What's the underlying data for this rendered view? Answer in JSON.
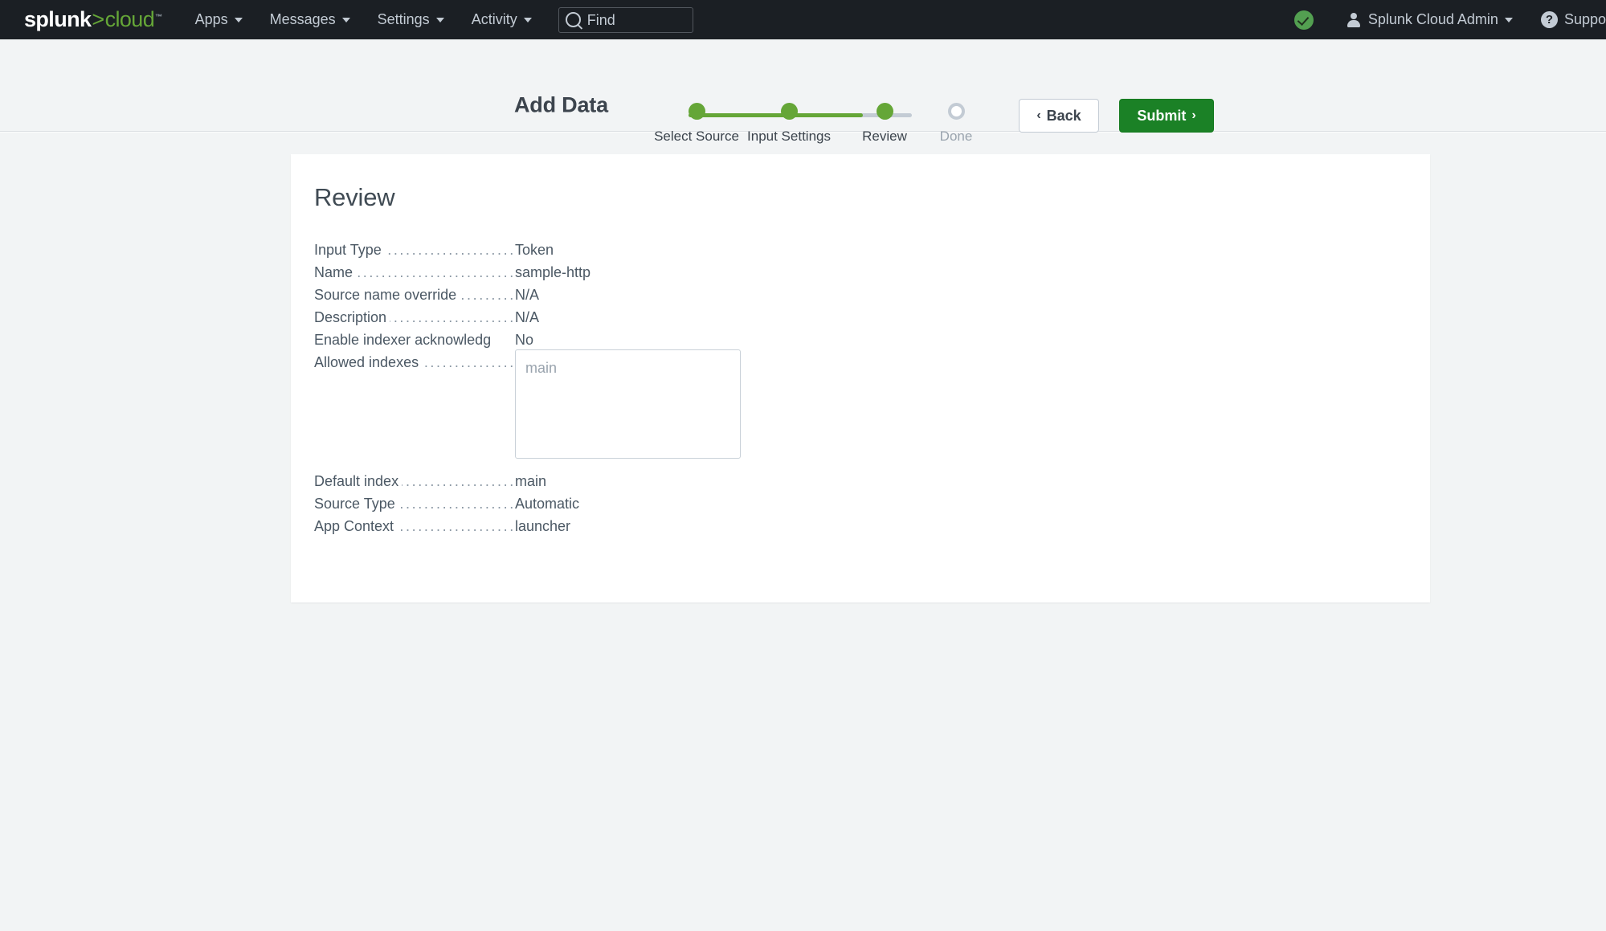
{
  "topnav": {
    "logo": {
      "part1": "splunk",
      "separator": ">",
      "part2": "cloud",
      "tm": "™"
    },
    "items": [
      {
        "label": "Apps",
        "name": "nav-apps"
      },
      {
        "label": "Messages",
        "name": "nav-messages"
      },
      {
        "label": "Settings",
        "name": "nav-settings"
      },
      {
        "label": "Activity",
        "name": "nav-activity"
      }
    ],
    "search": {
      "placeholder": "Find",
      "value": "",
      "icon": "search-icon"
    },
    "health_icon": "green-check-circle-icon",
    "user": {
      "label": "Splunk Cloud Admin",
      "icon": "person-icon"
    },
    "support": {
      "label": "Suppo",
      "icon": "question-circle-icon"
    },
    "colors": {
      "bar_bg": "#1b1f24",
      "text": "#c3cbd4",
      "accent_green": "#65a637",
      "health_green": "#53a051"
    }
  },
  "wizard": {
    "title": "Add Data",
    "steps": [
      {
        "label": "Select Source",
        "state": "complete"
      },
      {
        "label": "Input Settings",
        "state": "complete"
      },
      {
        "label": "Review",
        "state": "complete"
      },
      {
        "label": "Done",
        "state": "pending"
      }
    ],
    "back_label": "Back",
    "back_chevron": "‹",
    "submit_label": "Submit",
    "submit_chevron": "›",
    "colors": {
      "complete": "#65a637",
      "pending_ring": "#c3cbd4",
      "submit_bg": "#1b8126"
    }
  },
  "review": {
    "heading": "Review",
    "rows": [
      {
        "label": "Input Type",
        "value": "Token",
        "dots": true
      },
      {
        "label": "Name",
        "value": "sample-http",
        "dots": true
      },
      {
        "label": "Source name override",
        "value": "N/A",
        "dots": true
      },
      {
        "label": "Description",
        "value": "N/A",
        "dots": true
      },
      {
        "label": "Enable indexer acknowledg",
        "value": "No",
        "dots": false
      }
    ],
    "allowed_indexes": {
      "label": "Allowed indexes",
      "value": "main",
      "placeholder": "main"
    },
    "tail_rows": [
      {
        "label": "Default index",
        "value": "main",
        "dots": true
      },
      {
        "label": "Source Type",
        "value": "Automatic",
        "dots": true
      },
      {
        "label": "App Context",
        "value": "launcher",
        "dots": true
      }
    ],
    "leader_dots": "......................................................................."
  }
}
